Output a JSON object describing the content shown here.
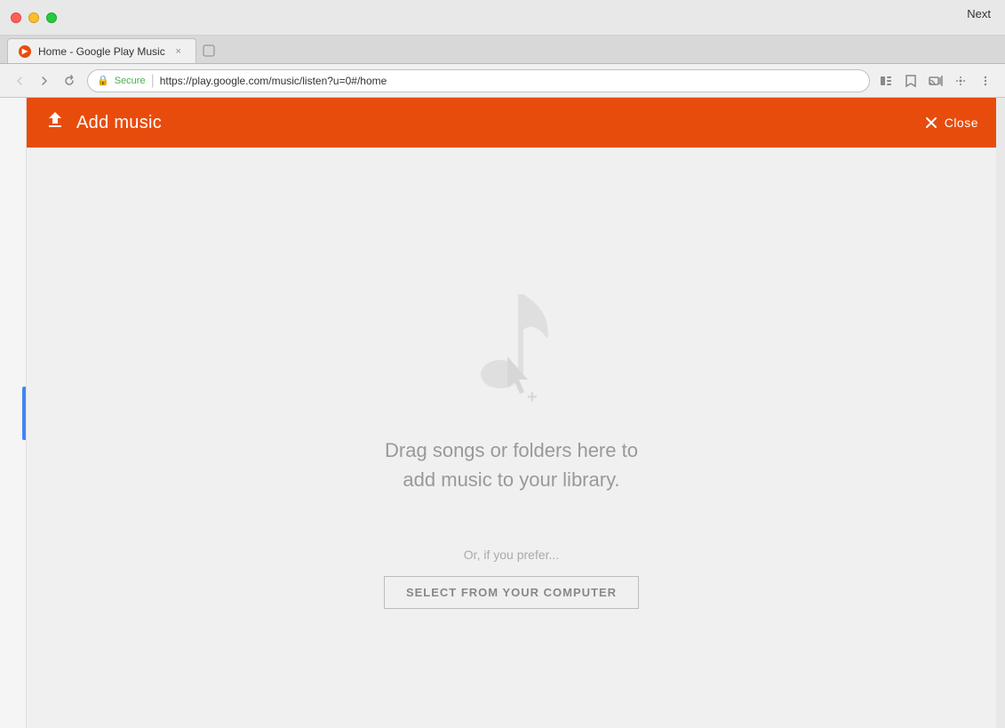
{
  "window": {
    "next_label": "Next"
  },
  "tab": {
    "title": "Home - Google Play Music",
    "favicon_label": "▶",
    "close_label": "×"
  },
  "addressbar": {
    "secure_label": "Secure",
    "url": "https://play.google.com/music/listen?u=0#/home"
  },
  "header": {
    "title": "Add music",
    "close_label": "Close",
    "upload_icon": "⬆"
  },
  "dropzone": {
    "drag_line1": "Drag songs or folders here to",
    "drag_line2": "add music to your library.",
    "prefer_text": "Or, if you prefer...",
    "select_button_label": "SELECT FROM YOUR COMPUTER"
  },
  "colors": {
    "accent": "#e84c0d",
    "secure_green": "#4caf50"
  }
}
